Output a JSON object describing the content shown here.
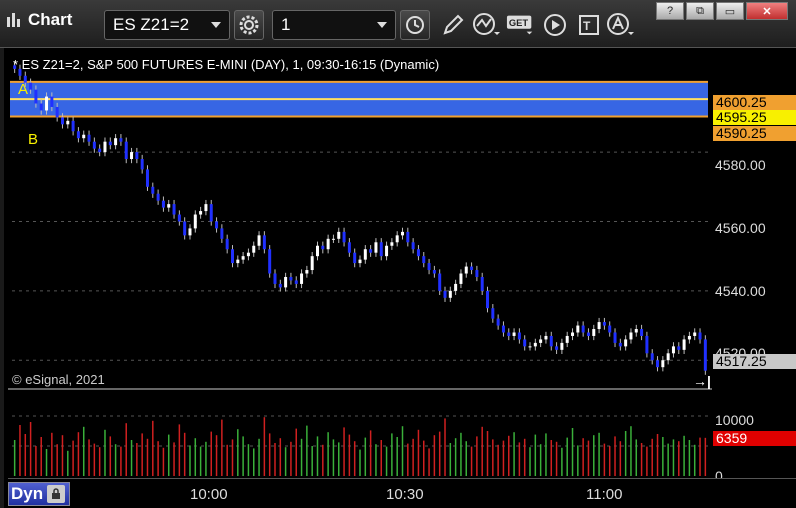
{
  "toolbar": {
    "app_title": "Chart",
    "symbol": "ES Z21=2",
    "interval": "1"
  },
  "chart": {
    "caption": "* ES Z21=2, S&P 500 FUTURES E-MINI (DAY), 1, 09:30-16:15 (Dynamic)",
    "copyright": "© eSignal, 2021",
    "marker_a": "A",
    "marker_b": "B",
    "dyn_label": "Dyn",
    "price_axis": [
      "4580.00",
      "4560.00",
      "4540.00",
      "4520.00"
    ],
    "volume_axis": [
      "10000",
      "0"
    ],
    "time_axis": [
      "10:00",
      "10:30",
      "11:00"
    ],
    "tags": {
      "upper": "4600.25",
      "mid": "4595.25",
      "lower": "4590.25",
      "last": "4517.25",
      "volume": "6359"
    },
    "colors": {
      "band": "#3a6cf0",
      "band_line": "#ffe060",
      "upper_tag": "#f0a030",
      "mid_tag": "#f8f000",
      "last_tag": "#c8c8c8",
      "volume_tag": "#e00000",
      "up_bar": "#ffffff",
      "down_bar": "#2030ff"
    }
  },
  "chart_data": {
    "type": "candlestick",
    "xlabel": "",
    "ylabel": "",
    "ylim": [
      4512,
      4610
    ],
    "x_ticks": [
      "10:00",
      "10:30",
      "11:00"
    ],
    "close": [
      4604,
      4602,
      4600,
      4598,
      4594,
      4592,
      4596,
      4593,
      4590,
      4588,
      4589,
      4586,
      4584,
      4585,
      4583,
      4581,
      4580,
      4583,
      4582,
      4584,
      4583,
      4578,
      4580,
      4578,
      4575,
      4570,
      4568,
      4566,
      4564,
      4565,
      4562,
      4560,
      4556,
      4558,
      4562,
      4563,
      4565,
      4560,
      4558,
      4555,
      4552,
      4548,
      4549,
      4550,
      4551,
      4553,
      4556,
      4552,
      4545,
      4542,
      4541,
      4544,
      4543,
      4542,
      4545,
      4546,
      4550,
      4553,
      4552,
      4555,
      4555,
      4557,
      4554,
      4551,
      4548,
      4549,
      4552,
      4551,
      4554,
      4550,
      4553,
      4554,
      4556,
      4557,
      4554,
      4552,
      4550,
      4548,
      4546,
      4545,
      4540,
      4538,
      4540,
      4542,
      4545,
      4547,
      4546,
      4544,
      4540,
      4535,
      4532,
      4530,
      4528,
      4527,
      4528,
      4526,
      4524,
      4524,
      4525,
      4526,
      4527,
      4524,
      4523,
      4525,
      4527,
      4528,
      4530,
      4528,
      4527,
      4529,
      4531,
      4530,
      4528,
      4525,
      4524,
      4526,
      4528,
      4529,
      4527,
      4522,
      4520,
      4518,
      4520,
      4522,
      4524,
      4523,
      4526,
      4527,
      4528,
      4526,
      4517
    ],
    "volume": [
      6000,
      8500,
      7000,
      9000,
      5000,
      6500,
      4500,
      7200,
      5300,
      6800,
      4200,
      5900,
      7300,
      8200,
      6100,
      5400,
      4800,
      7700,
      6600,
      5300,
      4900,
      8800,
      6000,
      5500,
      7100,
      6200,
      9200,
      5800,
      4700,
      6900,
      5600,
      8600,
      7200,
      5100,
      6300,
      4900,
      5700,
      7400,
      6800,
      9400,
      5200,
      6100,
      7800,
      6600,
      5300,
      4600,
      6200,
      9800,
      7100,
      5500,
      6300,
      4800,
      5700,
      7900,
      6200,
      8400,
      5000,
      6600,
      5200,
      7300,
      6100,
      5600,
      8100,
      6900,
      5800,
      4400,
      6400,
      7600,
      5300,
      6000,
      4900,
      7100,
      6500,
      8300,
      5400,
      6200,
      7700,
      5900,
      4600,
      6800,
      7400,
      9600,
      5500,
      6300,
      7200,
      5800,
      4900,
      6600,
      8200,
      7500,
      6100,
      5200,
      5900,
      6700,
      7300,
      5600,
      6200,
      4800,
      6900,
      5300,
      7100,
      6000,
      5700,
      4700,
      6400,
      8000,
      5100,
      6300,
      5900,
      6800,
      7200,
      5400,
      5000,
      6600,
      5800,
      7500,
      8300,
      6100,
      5500,
      4900,
      6200,
      7000,
      6500,
      5400,
      6100,
      5800,
      6700,
      6000,
      5200,
      6400,
      6359
    ]
  }
}
